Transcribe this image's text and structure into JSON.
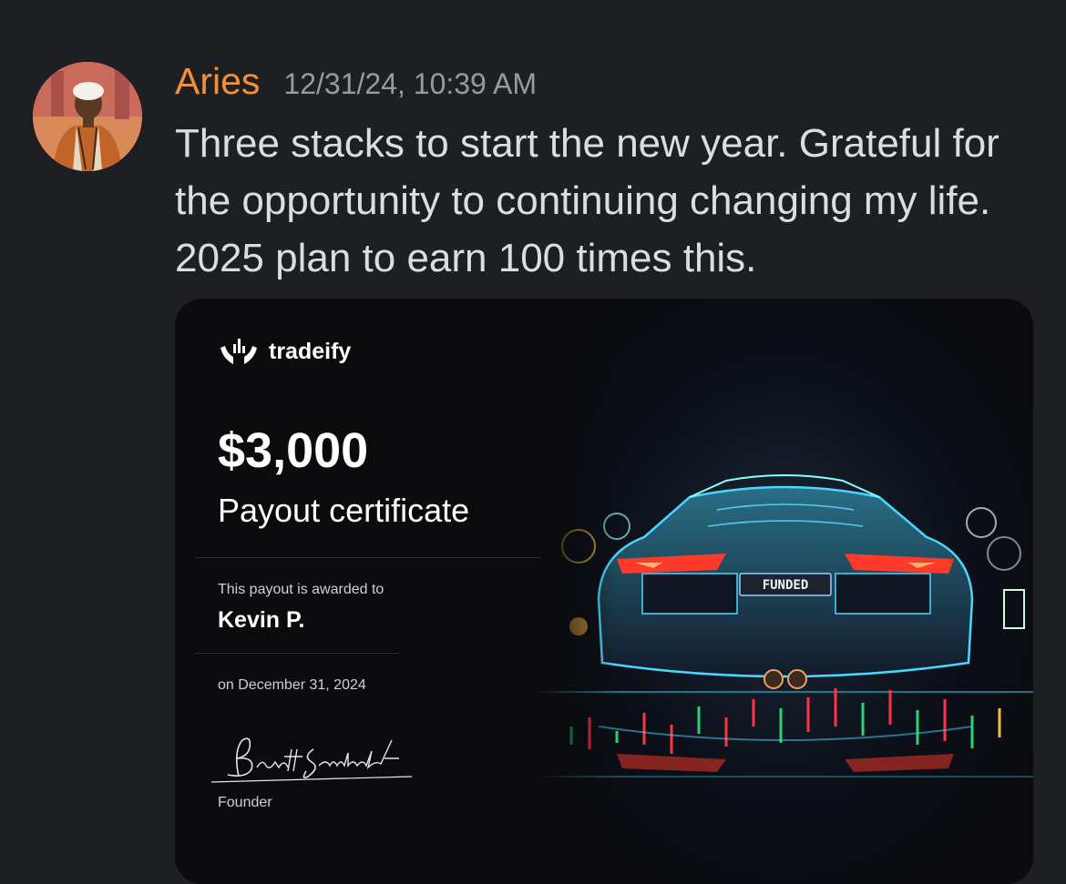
{
  "message": {
    "username": "Aries",
    "timestamp": "12/31/24, 10:39 AM",
    "text": "Three stacks to start the new year. Grateful for the opportunity to continuing changing my life. 2025 plan to earn 100 times this.",
    "username_color": "#f0913a"
  },
  "attachment": {
    "brand": "tradeify",
    "amount": "$3,000",
    "subtitle": "Payout certificate",
    "awarded_label": "This payout is awarded to",
    "recipient": "Kevin P.",
    "date": "on December 31, 2024",
    "signature": "Brett Simberkoff",
    "role": "Founder",
    "plate_text": "FUNDED"
  },
  "colors": {
    "background": "#1e1f22",
    "card": "#0b0b0e",
    "timestamp": "#949ba4",
    "text": "#dbdee1"
  }
}
